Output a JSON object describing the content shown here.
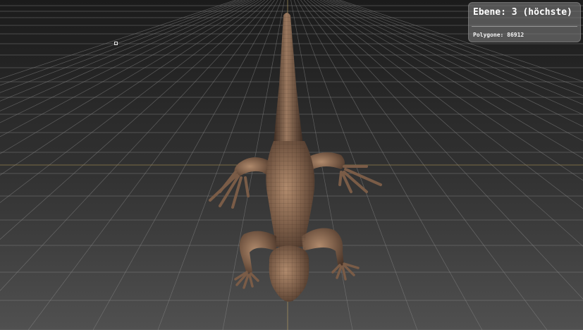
{
  "overlay": {
    "level_text": "Ebene: 3 (höchste)",
    "polygon_text": "Polygone: 86912"
  },
  "colors": {
    "background_top": "#1b1b1b",
    "background_bottom": "#505050",
    "grid_line": "#8a8a8a",
    "grid_axis": "#b59a55",
    "model_body": "#7a5c47",
    "model_highlight": "#b08a6c",
    "model_shadow": "#3e2c22",
    "panel_background": "#7a7a7a"
  },
  "icons": {
    "cursor": "cursor-square-icon"
  }
}
